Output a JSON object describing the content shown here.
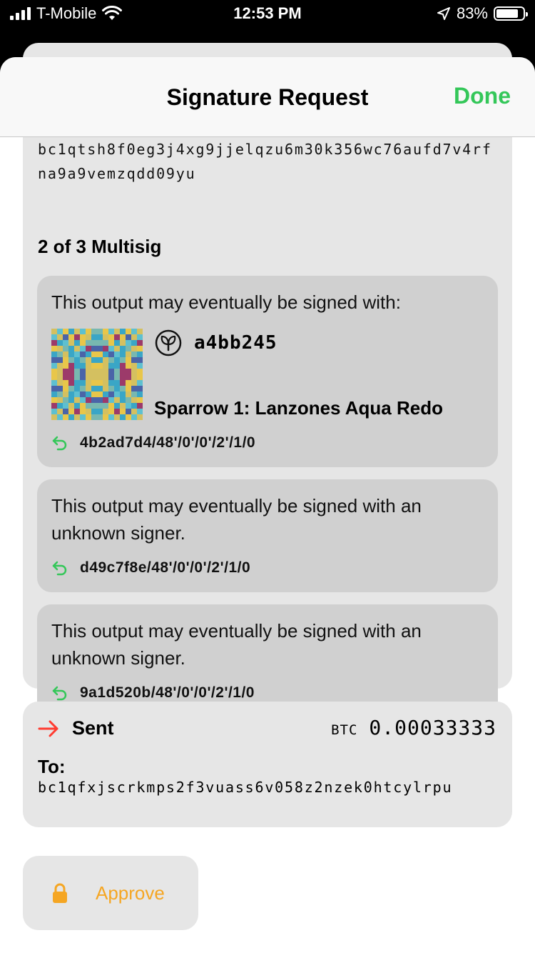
{
  "status_bar": {
    "carrier": "T-Mobile",
    "time": "12:53 PM",
    "battery": "83%",
    "battery_level": 0.83
  },
  "nav": {
    "title": "Signature Request",
    "done_label": "Done"
  },
  "input_card": {
    "address_line1": "bc1qtsh8f0eg3j4xg9jjelqzu6m30k356wc76aufd7v4rf",
    "address_line2": "na9a9vemzqdd09yu",
    "multisig_label": "2 of 3 Multisig",
    "signers": [
      {
        "text": "This output may eventually be signed with:",
        "fingerprint": "a4bb245",
        "wallet_name": "Sparrow 1: Lanzones Aqua Redo",
        "path": "4b2ad7d4/48'/0'/0'/2'/1/0"
      },
      {
        "text": "This output may eventually be signed with an unknown signer.",
        "path": "d49c7f8e/48'/0'/0'/2'/1/0"
      },
      {
        "text": "This output may eventually be signed with an unknown signer.",
        "path": "9a1d520b/48'/0'/0'/2'/1/0"
      }
    ]
  },
  "output_card": {
    "direction": "Sent",
    "unit": "BTC",
    "amount": "0.00033333",
    "to_label": "To:",
    "address": "bc1qfxjscrkmps2f3vuass6v058z2nzek0htcylrpu"
  },
  "approve": {
    "label": "Approve",
    "icon": "lock-icon"
  },
  "colors": {
    "accent_green": "#34c759",
    "sent_red": "#ff3b30",
    "approve_orange": "#f5a623",
    "card_bg": "#e6e6e6",
    "inner_card_bg": "#d0d0d0"
  },
  "icons": {
    "derivation": "return-arrow-icon",
    "sent": "arrow-right-icon",
    "seed": "leaf-icon"
  }
}
